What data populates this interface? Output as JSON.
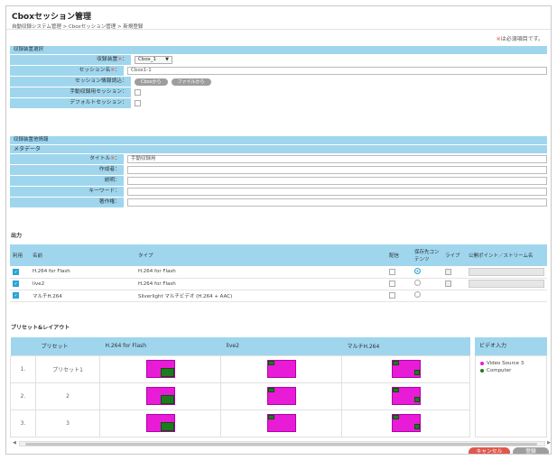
{
  "header": {
    "title": "Cboxセッション管理",
    "breadcrumb": "自動収録システム管理 > Cboxセッション管理 > 新規登録"
  },
  "required_note": {
    "mark": "※",
    "text": "は必須項目です。"
  },
  "device_section": {
    "title": "収録装置選択",
    "device_label": "収録装置",
    "device_value": "Cbox_1",
    "session_name_label": "セッション名",
    "session_name_value": "Cbox1-1",
    "session_read_label": "セッション情報読込：",
    "btn_from_cbox": "Cboxから",
    "btn_from_file": "ファイルから",
    "manual_label": "手動収録用セッション：",
    "default_label": "デフォルトセッション："
  },
  "meta_section": {
    "title": "収録装置他情報",
    "subtitle": "メタデータ",
    "title_label": "タイトル",
    "title_value": "手動収録用",
    "author_label": "作成者：",
    "desc_label": "説明：",
    "keyword_label": "キーワード：",
    "copyright_label": "著作権："
  },
  "required_mark": "※",
  "colon": "：",
  "output_section": {
    "title": "出力",
    "headers": {
      "use": "利用",
      "name": "名前",
      "type": "タイプ",
      "dist": "配信",
      "target": "保存先コンテンツ",
      "live": "ライブ",
      "publish": "公開ポイント／ストリーム名"
    },
    "rows": [
      {
        "name": "H.264 for Flash",
        "type": "H.264 for Flash",
        "use": true,
        "target": true
      },
      {
        "name": "live2",
        "type": "H.264 for Flash",
        "use": true,
        "target": false
      },
      {
        "name": "マルチH.264",
        "type": "Silverlight マルチビデオ (H.264 + AAC)",
        "use": true,
        "target": false
      }
    ]
  },
  "preset_section": {
    "title": "プリセット&レイアウト",
    "headers": {
      "preset": "プリセット",
      "col1": "H.264 for Flash",
      "col2": "live2",
      "col3": "マルチH.264",
      "video_input": "ビデオ入力"
    },
    "rows": [
      {
        "num": "1.",
        "name": "プリセット1"
      },
      {
        "num": "2.",
        "name": "2"
      },
      {
        "num": "3.",
        "name": "3"
      }
    ],
    "legend": [
      {
        "label": "Video Source 3",
        "color": "#e81bd7"
      },
      {
        "label": "Computer",
        "color": "#1f7a1f"
      }
    ]
  },
  "footer": {
    "cancel_label": "キャンセル",
    "register_label": "登録"
  },
  "colors": {
    "accent": "#9fd6ee",
    "required": "#e0584c",
    "cancel": "#e0584c",
    "register": "#9e9e9e",
    "checkbox": "#2aa3d8"
  }
}
